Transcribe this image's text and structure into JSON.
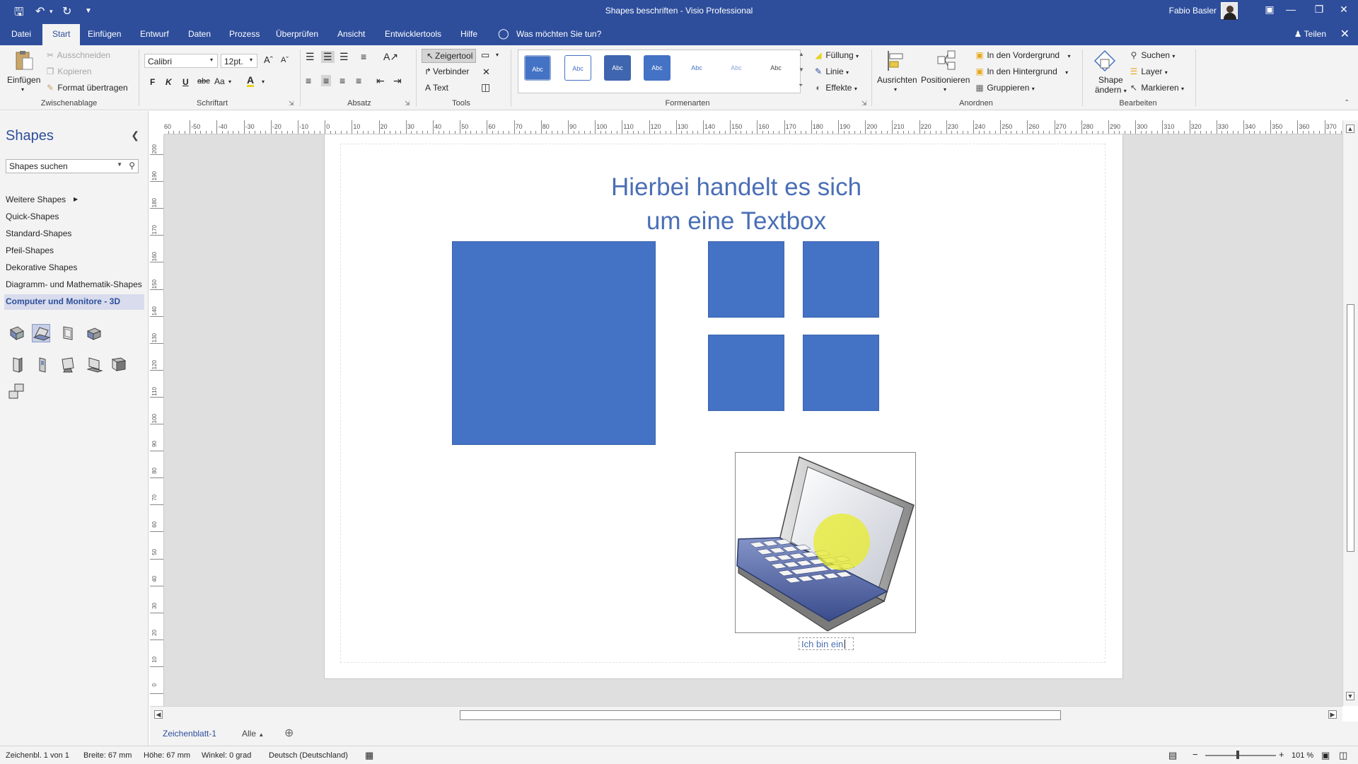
{
  "window": {
    "title": "Shapes beschriften  -  Visio Professional",
    "user": "Fabio Basler"
  },
  "tabs": {
    "items": [
      "Datei",
      "Start",
      "Einfügen",
      "Entwurf",
      "Daten",
      "Prozess",
      "Überprüfen",
      "Ansicht",
      "Entwicklertools",
      "Hilfe"
    ],
    "tell_me": "Was möchten Sie tun?",
    "share": "Teilen"
  },
  "ribbon": {
    "clipboard": {
      "paste": "Einfügen",
      "cut": "Ausschneiden",
      "copy": "Kopieren",
      "format_painter": "Format übertragen",
      "label": "Zwischenablage"
    },
    "font": {
      "family": "Calibri",
      "size": "12pt.",
      "bold": "F",
      "italic": "K",
      "underline": "U",
      "strike": "abc",
      "case": "Aa",
      "label": "Schriftart"
    },
    "paragraph": {
      "label": "Absatz"
    },
    "tools": {
      "pointer": "Zeigertool",
      "connector": "Verbinder",
      "text": "Text",
      "label": "Tools"
    },
    "shape_styles": {
      "swatch_text": "Abc",
      "fill": "Füllung",
      "line": "Linie",
      "effects": "Effekte",
      "label": "Formenarten"
    },
    "arrange": {
      "align": "Ausrichten",
      "position": "Positionieren",
      "bring_front": "In den Vordergrund",
      "send_back": "In den Hintergrund",
      "group": "Gruppieren",
      "label": "Anordnen"
    },
    "editing": {
      "change_shape_1": "Shape",
      "change_shape_2": "ändern",
      "find": "Suchen",
      "layer": "Layer",
      "select": "Markieren",
      "label": "Bearbeiten"
    }
  },
  "shapes_panel": {
    "title": "Shapes",
    "search_placeholder": "Shapes suchen",
    "stencils": [
      "Weitere Shapes",
      "Quick-Shapes",
      "Standard-Shapes",
      "Pfeil-Shapes",
      "Dekorative Shapes",
      "Diagramm- und Mathematik-Shapes",
      "Computer und Monitore - 3D"
    ]
  },
  "ruler": {
    "h_ticks": [
      "60",
      "-50",
      "-40",
      "-30",
      "-20",
      "-10",
      "0",
      "10",
      "20",
      "30",
      "40",
      "50",
      "60",
      "70",
      "80",
      "90",
      "100",
      "110",
      "120",
      "130",
      "140",
      "150",
      "160",
      "170",
      "180",
      "190",
      "200",
      "210",
      "220",
      "230",
      "240",
      "250",
      "260",
      "270",
      "280",
      "290",
      "300",
      "310",
      "320",
      "330",
      "340",
      "350",
      "360",
      "370"
    ],
    "v_ticks": [
      "200",
      "190",
      "180",
      "170",
      "160",
      "150",
      "140",
      "130",
      "120",
      "110",
      "100",
      "90",
      "80",
      "70",
      "60",
      "50",
      "40",
      "30",
      "20",
      "10",
      "0"
    ]
  },
  "drawing": {
    "title_line1": "Hierbei handelt es sich",
    "title_line2": "um eine Textbox",
    "caption": "Ich bin ein",
    "shape_color": "#4472c4"
  },
  "sheets": {
    "current": "Zeichenblatt-1",
    "all": "Alle"
  },
  "status": {
    "page": "Zeichenbl. 1 von 1",
    "width": "Breite: 67 mm",
    "height": "Höhe: 67 mm",
    "angle": "Winkel: 0 grad",
    "language": "Deutsch (Deutschland)",
    "zoom": "101 %"
  }
}
